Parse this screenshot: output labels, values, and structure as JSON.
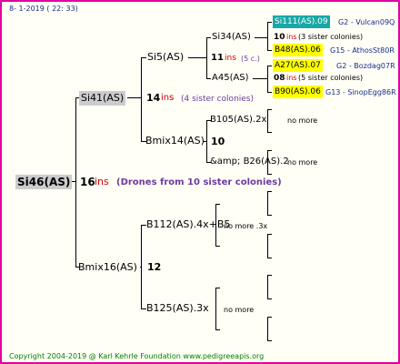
{
  "date": "8-  1-2019 ( 22: 33)",
  "footer": "Copyright 2004-2019 @ Karl Kehrle Foundation   www.pedigreeapis.org",
  "root": {
    "label": "Si46(AS)",
    "count": "16",
    "ins": "ins",
    "note": "(Drones from 10 sister colonies)"
  },
  "gen1": {
    "top": {
      "label": "Si41(AS)",
      "count": "14",
      "ins": "ins",
      "note": "(4 sister colonies)"
    },
    "bottom": {
      "label": "Bmix16(AS)",
      "count": "12"
    }
  },
  "gen2": {
    "si5": {
      "label": "Si5(AS)",
      "count": "11",
      "ins": "ins",
      "note": "(5 c.)"
    },
    "bmix14": {
      "label": "Bmix14(AS)",
      "count": "10"
    },
    "b112": {
      "label": "B112(AS).4x+B5",
      "note": "no more .3x"
    },
    "b125": {
      "label": "B125(AS).3x",
      "note": "no more"
    }
  },
  "gen3": {
    "si34": {
      "label": "Si34(AS)",
      "count": "10",
      "ins": "ins",
      "note": "(3 sister colonies)"
    },
    "a45": {
      "label": "A45(AS)",
      "count": "08",
      "ins": "ins",
      "note": "(5 sister colonies)"
    },
    "b105": {
      "label": "B105(AS).2x",
      "note": "no more"
    },
    "b26": {
      "label": "&amp; B26(AS).2",
      "note": "no more"
    }
  },
  "gen4": {
    "si111": {
      "label": "Si111(AS).09",
      "info": "G2 - Vulcan09Q"
    },
    "b48": {
      "label": "B48(AS).06",
      "info": "G15 - AthosSt80R"
    },
    "a27": {
      "label": "A27(AS).07",
      "info": "G2 - Bozdag07R"
    },
    "b90": {
      "label": "B90(AS).06",
      "info": "G13 - SinopEgg86R"
    }
  },
  "colors": {
    "border": "#e000a0",
    "teal": "#19a8a8",
    "yellow": "#ffff00",
    "grey": "#cccccc"
  }
}
